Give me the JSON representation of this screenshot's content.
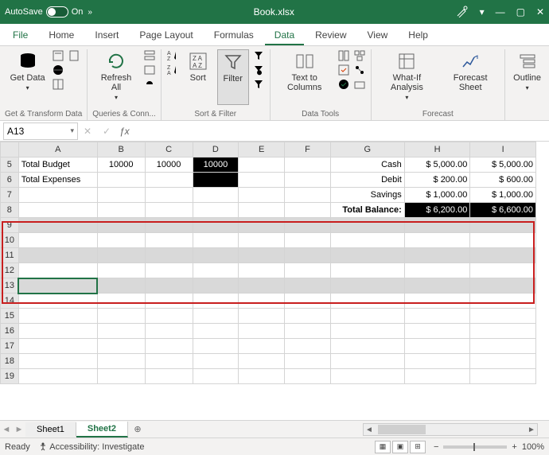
{
  "titlebar": {
    "autosave_label": "AutoSave",
    "autosave_state": "On",
    "filename": "Book.xlsx",
    "minimize": "—",
    "maximize": "▢",
    "close": "✕"
  },
  "tabs": {
    "file": "File",
    "home": "Home",
    "insert": "Insert",
    "layout": "Page Layout",
    "formulas": "Formulas",
    "data": "Data",
    "review": "Review",
    "view": "View",
    "help": "Help"
  },
  "ribbon": {
    "getdata": "Get Data",
    "refresh": "Refresh All",
    "sort": "Sort",
    "filter": "Filter",
    "t2c": "Text to Columns",
    "whatif": "What-If Analysis",
    "forecast": "Forecast Sheet",
    "outline": "Outline",
    "g1": "Get & Transform Data",
    "g2": "Queries & Conn...",
    "g3": "Sort & Filter",
    "g4": "Data Tools",
    "g5": "Forecast"
  },
  "formula": {
    "namebox": "A13",
    "fx": "ƒx"
  },
  "cols": [
    "A",
    "B",
    "C",
    "D",
    "E",
    "F",
    "G",
    "H",
    "I"
  ],
  "rows_visible": [
    "5",
    "6",
    "7",
    "8",
    "9",
    "10",
    "11",
    "12",
    "13",
    "14",
    "15",
    "16",
    "17",
    "18",
    "19"
  ],
  "cells": {
    "A5": "Total Budget",
    "B5": "10000",
    "C5": "10000",
    "D5": "10000",
    "G5": "Cash",
    "H5": "$  5,000.00",
    "I5": "$  5,000.00",
    "A6": "Total Expenses",
    "G6": "Debit",
    "H6": "$     200.00",
    "I6": "$     600.00",
    "G7": "Savings",
    "H7": "$  1,000.00",
    "I7": "$  1,000.00",
    "G8": "Total Balance:",
    "H8": "$  6,200.00",
    "I8": "$  6,600.00"
  },
  "sheets": {
    "s1": "Sheet1",
    "s2": "Sheet2",
    "add": "⊕"
  },
  "status": {
    "ready": "Ready",
    "access": "Accessibility: Investigate",
    "zoom": "100%",
    "minus": "−",
    "plus": "+"
  }
}
